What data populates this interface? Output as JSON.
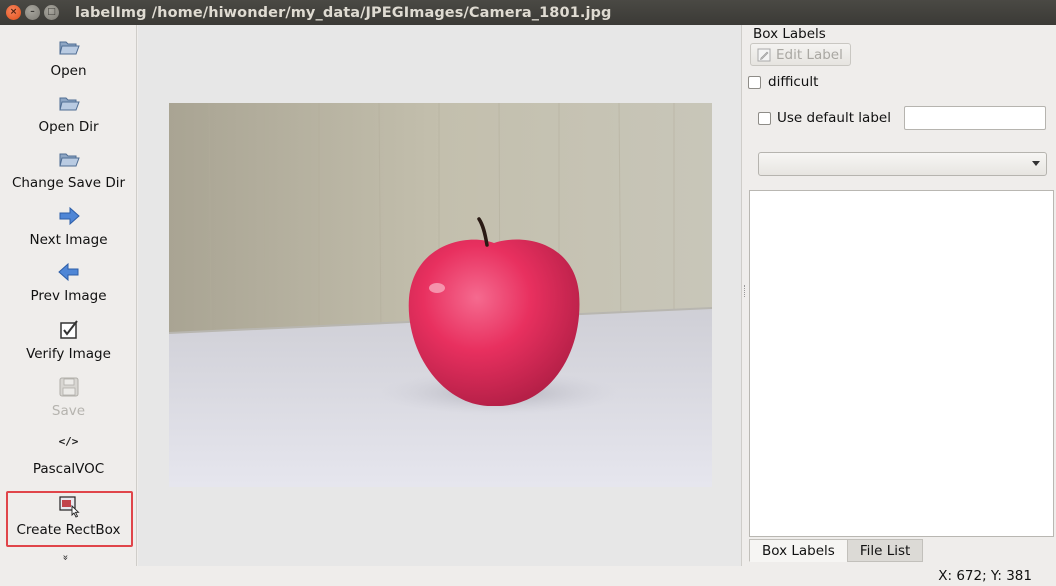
{
  "window": {
    "title": "labelImg /home/hiwonder/my_data/JPEGImages/Camera_1801.jpg",
    "close_glyph": "×",
    "minimize_glyph": "–",
    "maximize_glyph": "□"
  },
  "toolbar": {
    "items": [
      {
        "label": "Open",
        "icon": "folder-open-icon"
      },
      {
        "label": "Open Dir",
        "icon": "folder-open-icon"
      },
      {
        "label": "Change Save Dir",
        "icon": "folder-open-icon"
      },
      {
        "label": "Next Image",
        "icon": "arrow-right-icon"
      },
      {
        "label": "Prev Image",
        "icon": "arrow-left-icon"
      },
      {
        "label": "Verify Image",
        "icon": "checkbox-icon"
      },
      {
        "label": "Save",
        "icon": "floppy-disk-icon",
        "disabled": true
      },
      {
        "label": "PascalVOC",
        "icon": "code-tag-icon",
        "glyph": "</>"
      },
      {
        "label": "Create RectBox",
        "icon": "create-rect-icon"
      }
    ],
    "more_glyph": "»",
    "highlight_color": "#e0454a"
  },
  "canvas": {
    "image_name": "Camera_1801.jpg"
  },
  "dock": {
    "title": "Box Labels",
    "edit_label": "Edit Label",
    "difficult_label": "difficult",
    "use_default_label": "Use default label",
    "default_label_value": "",
    "label_combo_value": "",
    "tabs": [
      {
        "label": "Box Labels",
        "active": true
      },
      {
        "label": "File List",
        "active": false
      }
    ]
  },
  "status": {
    "text": "X: 672; Y: 381"
  }
}
